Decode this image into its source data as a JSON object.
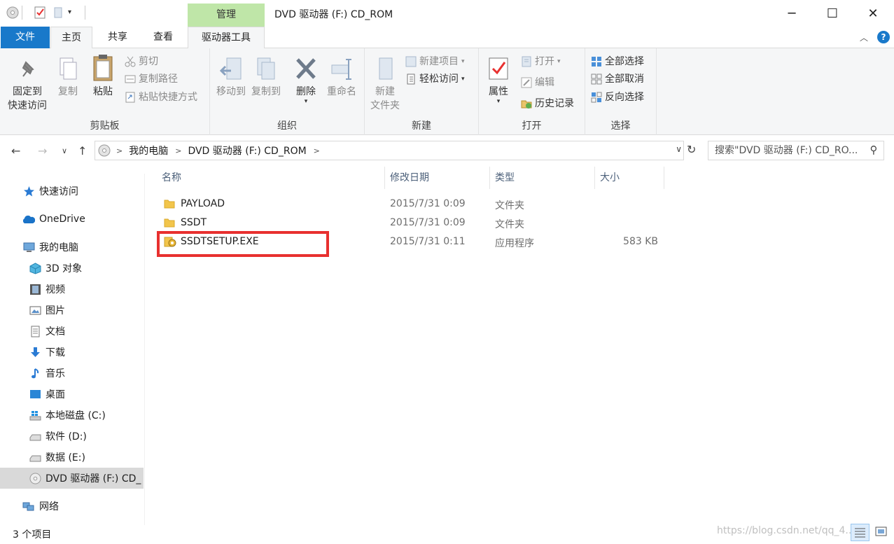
{
  "window": {
    "title": "DVD 驱动器 (F:) CD_ROM",
    "contextual_tab_group": "管理",
    "controls": {
      "minimize": "─",
      "maximize": "☐",
      "close": "✕"
    }
  },
  "ribbon_tabs": [
    "文件",
    "主页",
    "共享",
    "查看",
    "驱动器工具"
  ],
  "ribbon": {
    "clipboard": {
      "label": "剪贴板",
      "pin_line1": "固定到",
      "pin_line2": "快速访问",
      "copy": "复制",
      "paste": "粘贴",
      "cut": "剪切",
      "copy_path": "复制路径",
      "paste_shortcut": "粘贴快捷方式"
    },
    "organize": {
      "label": "组织",
      "move_to": "移动到",
      "copy_to": "复制到",
      "delete": "删除",
      "rename": "重命名"
    },
    "new": {
      "label": "新建",
      "new_folder_line1": "新建",
      "new_folder_line2": "文件夹",
      "new_item": "新建项目",
      "easy_access": "轻松访问"
    },
    "open": {
      "label": "打开",
      "properties": "属性",
      "open": "打开",
      "edit": "编辑",
      "history": "历史记录"
    },
    "select": {
      "label": "选择",
      "select_all": "全部选择",
      "select_none": "全部取消",
      "invert": "反向选择"
    }
  },
  "address": {
    "crumbs": [
      "我的电脑",
      "DVD 驱动器 (F:) CD_ROM"
    ],
    "search_placeholder": "搜索\"DVD 驱动器 (F:) CD_RO..."
  },
  "sidebar": {
    "items": [
      {
        "label": "快速访问",
        "icon": "star-icon"
      },
      {
        "label": "OneDrive",
        "icon": "cloud-icon"
      },
      {
        "label": "我的电脑",
        "icon": "computer-icon"
      },
      {
        "label": "3D 对象",
        "icon": "cube-icon"
      },
      {
        "label": "视频",
        "icon": "film-icon"
      },
      {
        "label": "图片",
        "icon": "picture-icon"
      },
      {
        "label": "文档",
        "icon": "document-icon"
      },
      {
        "label": "下载",
        "icon": "download-icon"
      },
      {
        "label": "音乐",
        "icon": "music-icon"
      },
      {
        "label": "桌面",
        "icon": "desktop-icon"
      },
      {
        "label": "本地磁盘 (C:)",
        "icon": "windows-drive-icon"
      },
      {
        "label": "软件 (D:)",
        "icon": "drive-icon"
      },
      {
        "label": "数据 (E:)",
        "icon": "drive-icon"
      },
      {
        "label": "DVD 驱动器 (F:) CD_",
        "icon": "dvd-icon"
      },
      {
        "label": "网络",
        "icon": "network-icon"
      }
    ]
  },
  "file_list": {
    "columns": [
      "名称",
      "修改日期",
      "类型",
      "大小"
    ],
    "rows": [
      {
        "name": "PAYLOAD",
        "date": "2015/7/31 0:09",
        "type": "文件夹",
        "size": "",
        "icon": "folder-icon"
      },
      {
        "name": "SSDT",
        "date": "2015/7/31 0:09",
        "type": "文件夹",
        "size": "",
        "icon": "folder-icon"
      },
      {
        "name": "SSDTSETUP.EXE",
        "date": "2015/7/31 0:11",
        "type": "应用程序",
        "size": "583 KB",
        "icon": "setup-icon"
      }
    ]
  },
  "status": {
    "item_count": "3 个项目",
    "watermark": "https://blog.csdn.net/qq_4..."
  },
  "colors": {
    "accent": "#1979ca",
    "manage_tab": "#bfe6a8",
    "highlight": "#e8302f",
    "selected": "#d9d9d9"
  }
}
